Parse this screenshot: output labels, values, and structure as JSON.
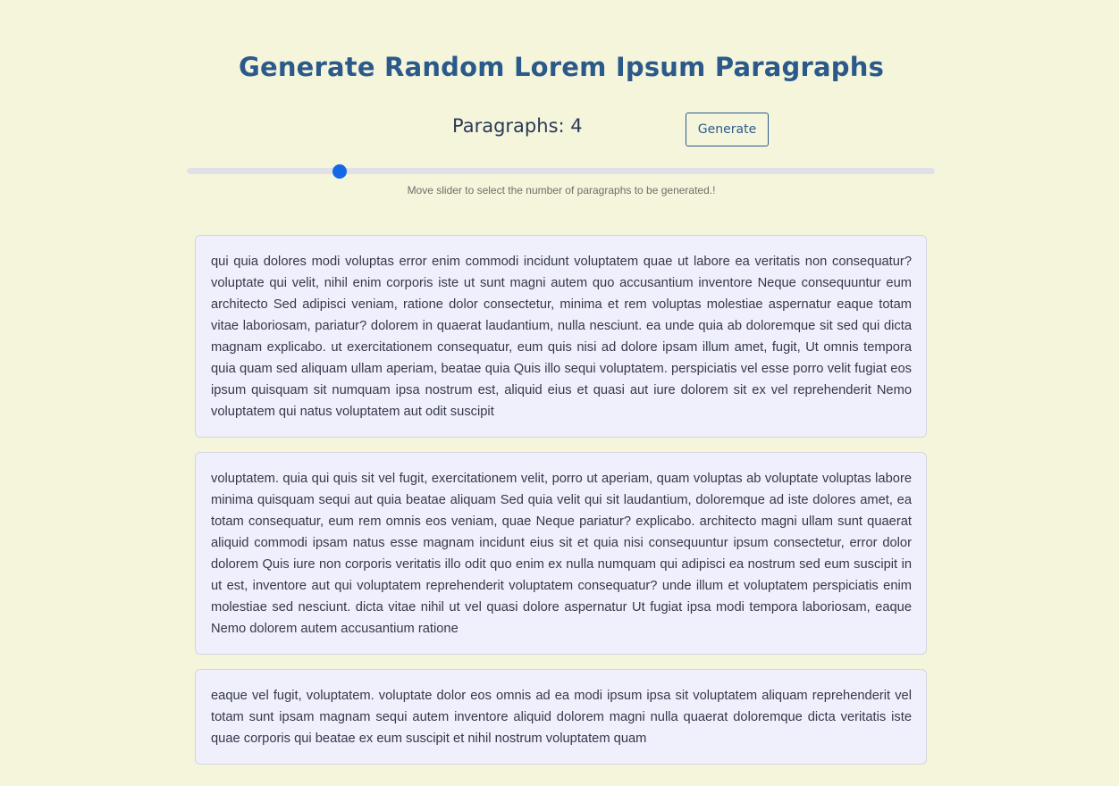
{
  "title": "Generate Random Lorem Ipsum Paragraphs",
  "controls": {
    "count_label": "Paragraphs: 4",
    "generate_label": "Generate"
  },
  "slider": {
    "value": 4,
    "min": 1,
    "max": 20,
    "fill_fraction": 0.204,
    "hint": "Move slider to select the number of paragraphs to be generated.!"
  },
  "colors": {
    "background": "#f5f5dc",
    "title": "#2b5a8a",
    "slider_thumb": "#1467e6",
    "card_background": "#eff0fb"
  },
  "paragraphs": [
    "qui quia dolores modi voluptas error enim commodi incidunt voluptatem quae ut labore ea veritatis non consequatur? voluptate qui velit, nihil enim corporis iste ut sunt magni autem quo accusantium inventore Neque consequuntur eum architecto Sed adipisci veniam, ratione dolor consectetur, minima et rem voluptas molestiae aspernatur eaque totam vitae laboriosam, pariatur? dolorem in quaerat laudantium, nulla nesciunt. ea unde quia ab doloremque sit sed qui dicta magnam explicabo. ut exercitationem consequatur, eum quis nisi ad dolore ipsam illum amet, fugit, Ut omnis tempora quia quam sed aliquam ullam aperiam, beatae quia Quis illo sequi voluptatem. perspiciatis vel esse porro velit fugiat eos ipsum quisquam sit numquam ipsa nostrum est, aliquid eius et quasi aut iure dolorem sit ex vel reprehenderit Nemo voluptatem qui natus voluptatem aut odit suscipit",
    "voluptatem. quia qui quis sit vel fugit, exercitationem velit, porro ut aperiam, quam voluptas ab voluptate voluptas labore minima quisquam sequi aut quia beatae aliquam Sed quia velit qui sit laudantium, doloremque ad iste dolores amet, ea totam consequatur, eum rem omnis eos veniam, quae Neque pariatur? explicabo. architecto magni ullam sunt quaerat aliquid commodi ipsam natus esse magnam incidunt eius sit et quia nisi consequuntur ipsum consectetur, error dolor dolorem Quis iure non corporis veritatis illo odit quo enim ex nulla numquam qui adipisci ea nostrum sed eum suscipit in ut est, inventore aut qui voluptatem reprehenderit voluptatem consequatur? unde illum et voluptatem perspiciatis enim molestiae sed nesciunt. dicta vitae nihil ut vel quasi dolore aspernatur Ut fugiat ipsa modi tempora laboriosam, eaque Nemo dolorem autem accusantium ratione",
    "eaque vel fugit, voluptatem. voluptate dolor eos omnis ad ea modi ipsum ipsa sit voluptatem aliquam reprehenderit vel totam sunt ipsam magnam sequi autem inventore aliquid dolorem magni nulla quaerat doloremque dicta veritatis iste quae corporis qui beatae ex eum suscipit et nihil nostrum voluptatem quam"
  ]
}
